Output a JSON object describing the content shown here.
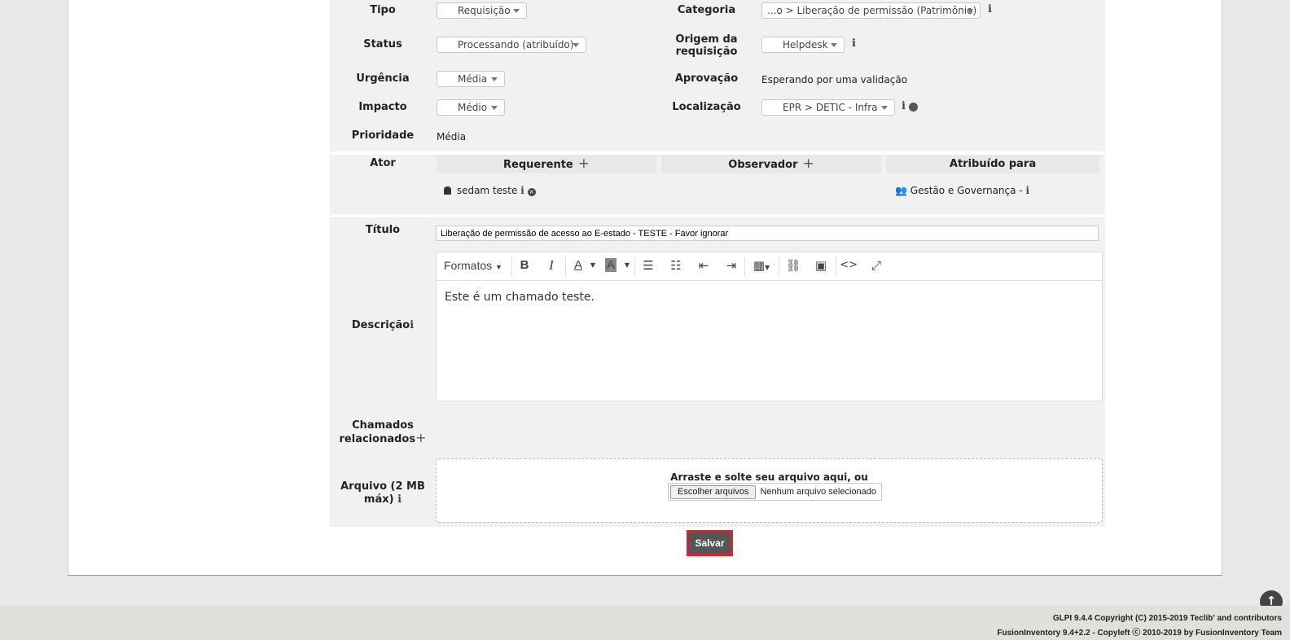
{
  "ticket": {
    "tipo": {
      "label": "Tipo",
      "value": "Requisição"
    },
    "categoria": {
      "label": "Categoria",
      "value": "...o > Liberação de permissão (Patrimônio)"
    },
    "status": {
      "label": "Status",
      "value": "Processando (atribuído)"
    },
    "origem": {
      "label": "Origem da requisição",
      "value": "Helpdesk"
    },
    "urgencia": {
      "label": "Urgência",
      "value": "Média"
    },
    "aprovacao": {
      "label": "Aprovação",
      "value": "Esperando por uma validação"
    },
    "impacto": {
      "label": "Impacto",
      "value": "Médio"
    },
    "localizacao": {
      "label": "Localização",
      "value": "EPR > DETIC - Infra"
    },
    "prioridade": {
      "label": "Prioridade",
      "value": "Média"
    }
  },
  "actors": {
    "label": "Ator",
    "requerente": "Requerente",
    "observador": "Observador",
    "atribuido": "Atribuído para",
    "requester_name": "sedam teste",
    "assigned_group": "Gestão e Governança -"
  },
  "form": {
    "titulo_label": "Título",
    "titulo_value": "Liberação de permissão de acesso ao E-estado - TESTE - Favor ignorar",
    "descricao_label": "Descrição",
    "descricao_text": "Este é um chamado teste.",
    "formatos": "Formatos",
    "chamados_label": "Chamados relacionados",
    "arquivo_label": "Arquivo (2 MB máx)",
    "drop_text": "Arraste e solte seu arquivo aqui, ou",
    "choose_files": "Escolher arquivos",
    "no_file": "Nenhum arquivo selecionado",
    "save": "Salvar"
  },
  "footer": {
    "line1": "GLPI 9.4.4 Copyright (C) 2015-2019 Teclib' and contributors",
    "line2": "FusionInventory 9.4+2.2 - Copyleft ⓒ 2010-2019 by FusionInventory Team"
  },
  "colors": {
    "save_bg": "#555555",
    "save_border": "#e0202c",
    "panel": "#f1f1f1"
  }
}
